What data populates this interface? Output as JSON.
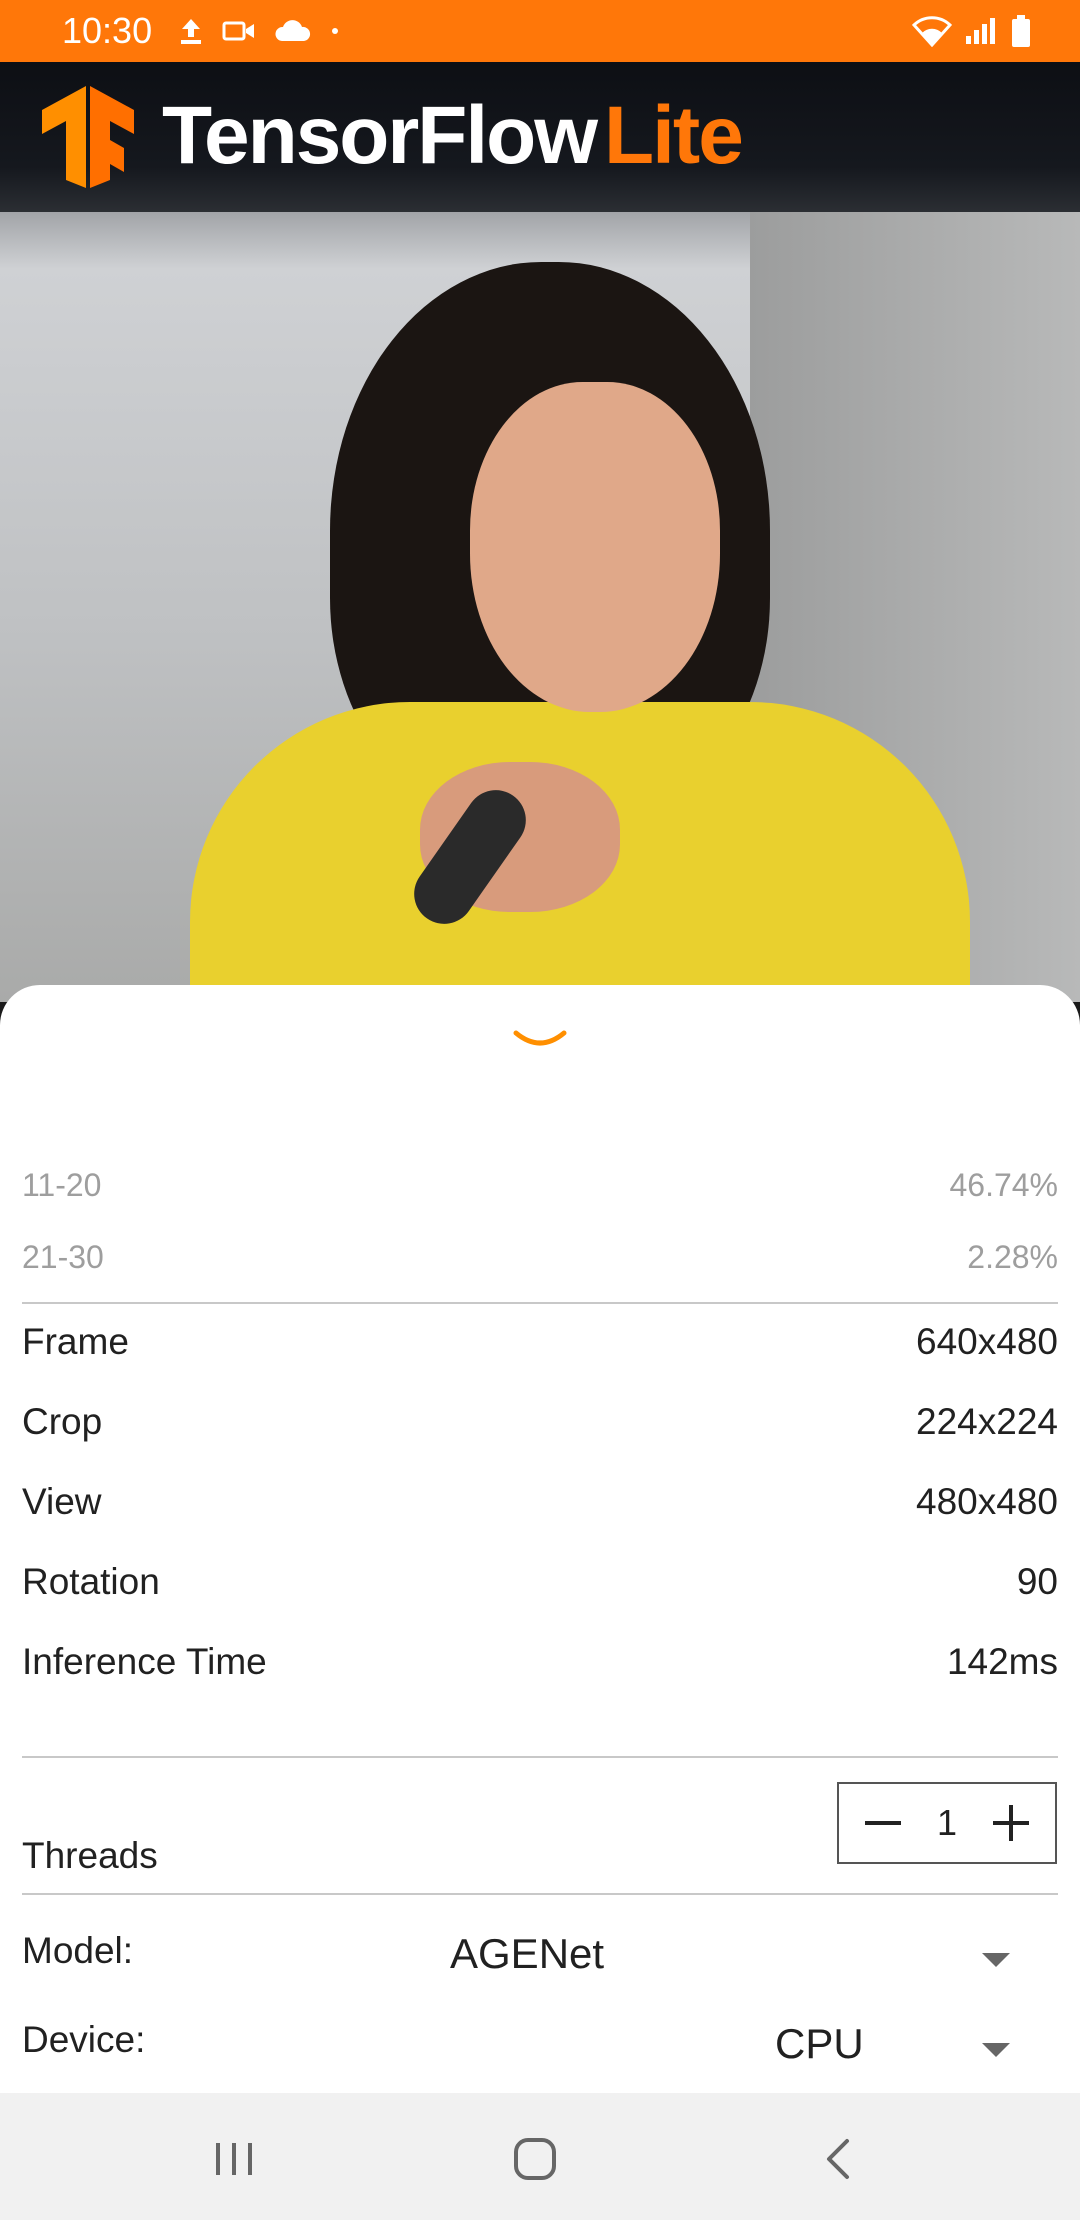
{
  "status_bar": {
    "time": "10:30",
    "icons_left": [
      "upload-icon",
      "video-call-icon",
      "cloud-icon",
      "dot-icon"
    ],
    "icons_right": [
      "wifi-icon",
      "signal-icon",
      "battery-icon"
    ],
    "background": "#ff7709"
  },
  "header": {
    "brand_primary": "TensorFlow",
    "brand_secondary": "Lite",
    "logo_icon": "tensorflow-logo-icon",
    "accent_color": "#ff7709"
  },
  "results": [
    {
      "label": "11-20",
      "value": "46.74%"
    },
    {
      "label": "21-30",
      "value": "2.28%"
    }
  ],
  "info": {
    "frame_label": "Frame",
    "frame_value": "640x480",
    "crop_label": "Crop",
    "crop_value": "224x224",
    "view_label": "View",
    "view_value": "480x480",
    "rotation_label": "Rotation",
    "rotation_value": "90",
    "inference_label": "Inference Time",
    "inference_value": "142ms"
  },
  "threads": {
    "label": "Threads",
    "value": "1"
  },
  "model": {
    "label": "Model:",
    "value": "AGENet"
  },
  "device": {
    "label": "Device:",
    "value": "CPU"
  },
  "nav_bar": {
    "icons": [
      "recent-apps-icon",
      "home-icon",
      "back-icon"
    ]
  }
}
